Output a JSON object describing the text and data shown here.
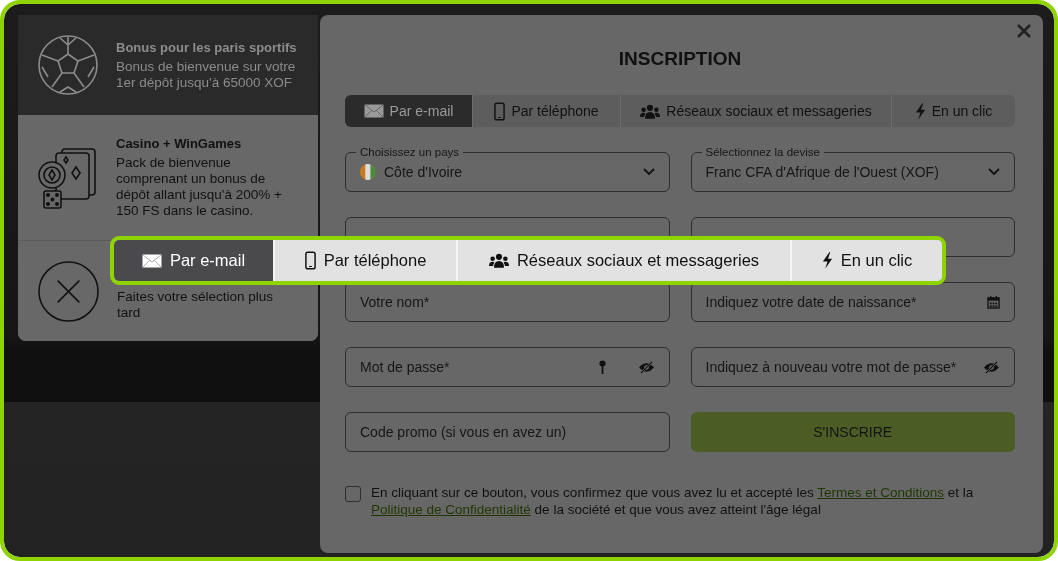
{
  "bonus_options": [
    {
      "kind": "sports",
      "selected": true,
      "title": "Bonus pour les paris sportifs",
      "description": "Bonus de bienvenue sur votre 1er dépôt jusqu'à 65000 XOF"
    },
    {
      "kind": "casino",
      "selected": false,
      "title": "Casino + WinGames",
      "description": "Pack de bienvenue comprenant un bonus de dépôt allant jusqu'à 200% + 150 FS dans le casino."
    },
    {
      "kind": "none",
      "selected": false,
      "description": "Faites votre sélection plus tard"
    }
  ],
  "modal": {
    "title": "INSCRIPTION",
    "tabs": [
      {
        "kind": "envelope",
        "label": "Par e-mail",
        "selected": true
      },
      {
        "kind": "phone",
        "label": "Par téléphone",
        "selected": false
      },
      {
        "kind": "people",
        "label": "Réseaux sociaux et messageries",
        "selected": false
      },
      {
        "kind": "bolt",
        "label": "En un clic",
        "selected": false
      }
    ],
    "fields": [
      {
        "kind": "country",
        "label": "Choisissez un pays",
        "value": "Côte d'Ivoire"
      },
      {
        "kind": "select",
        "label": "Sélectionnez la devise",
        "value": "Franc CFA d'Afrique de l'Ouest (XOF)"
      },
      {
        "kind": "covered"
      },
      {
        "kind": "covered"
      },
      {
        "kind": "text",
        "placeholder": "Votre nom*"
      },
      {
        "kind": "date",
        "placeholder": "Indiquez votre date de naissance*"
      },
      {
        "kind": "password",
        "placeholder": "Mot de passe*"
      },
      {
        "kind": "password-confirm",
        "placeholder": "Indiquez à nouveau votre mot de passe*"
      },
      {
        "kind": "text",
        "placeholder": "Code promo (si vous en avez un)"
      },
      {
        "kind": "submit",
        "label": "S'INSCRIRE"
      }
    ],
    "consent": {
      "checked": false,
      "parts": [
        {
          "kind": "text",
          "text": "En cliquant sur ce bouton, vous confirmez que vous avez lu et accepté les "
        },
        {
          "kind": "link",
          "text": "Termes et Conditions"
        },
        {
          "kind": "text",
          "text": " et la "
        },
        {
          "kind": "link",
          "text": "Politique de Confidentialité"
        },
        {
          "kind": "text",
          "text": " de la société et que vous avez atteint l'âge légal"
        }
      ]
    }
  },
  "callout": {
    "tabs": [
      {
        "kind": "envelope",
        "label": "Par e-mail",
        "selected": true
      },
      {
        "kind": "phone",
        "label": "Par téléphone",
        "selected": false
      },
      {
        "kind": "people",
        "label": "Réseaux sociaux et messageries",
        "selected": false
      },
      {
        "kind": "bolt",
        "label": "En un clic",
        "selected": false
      }
    ]
  }
}
